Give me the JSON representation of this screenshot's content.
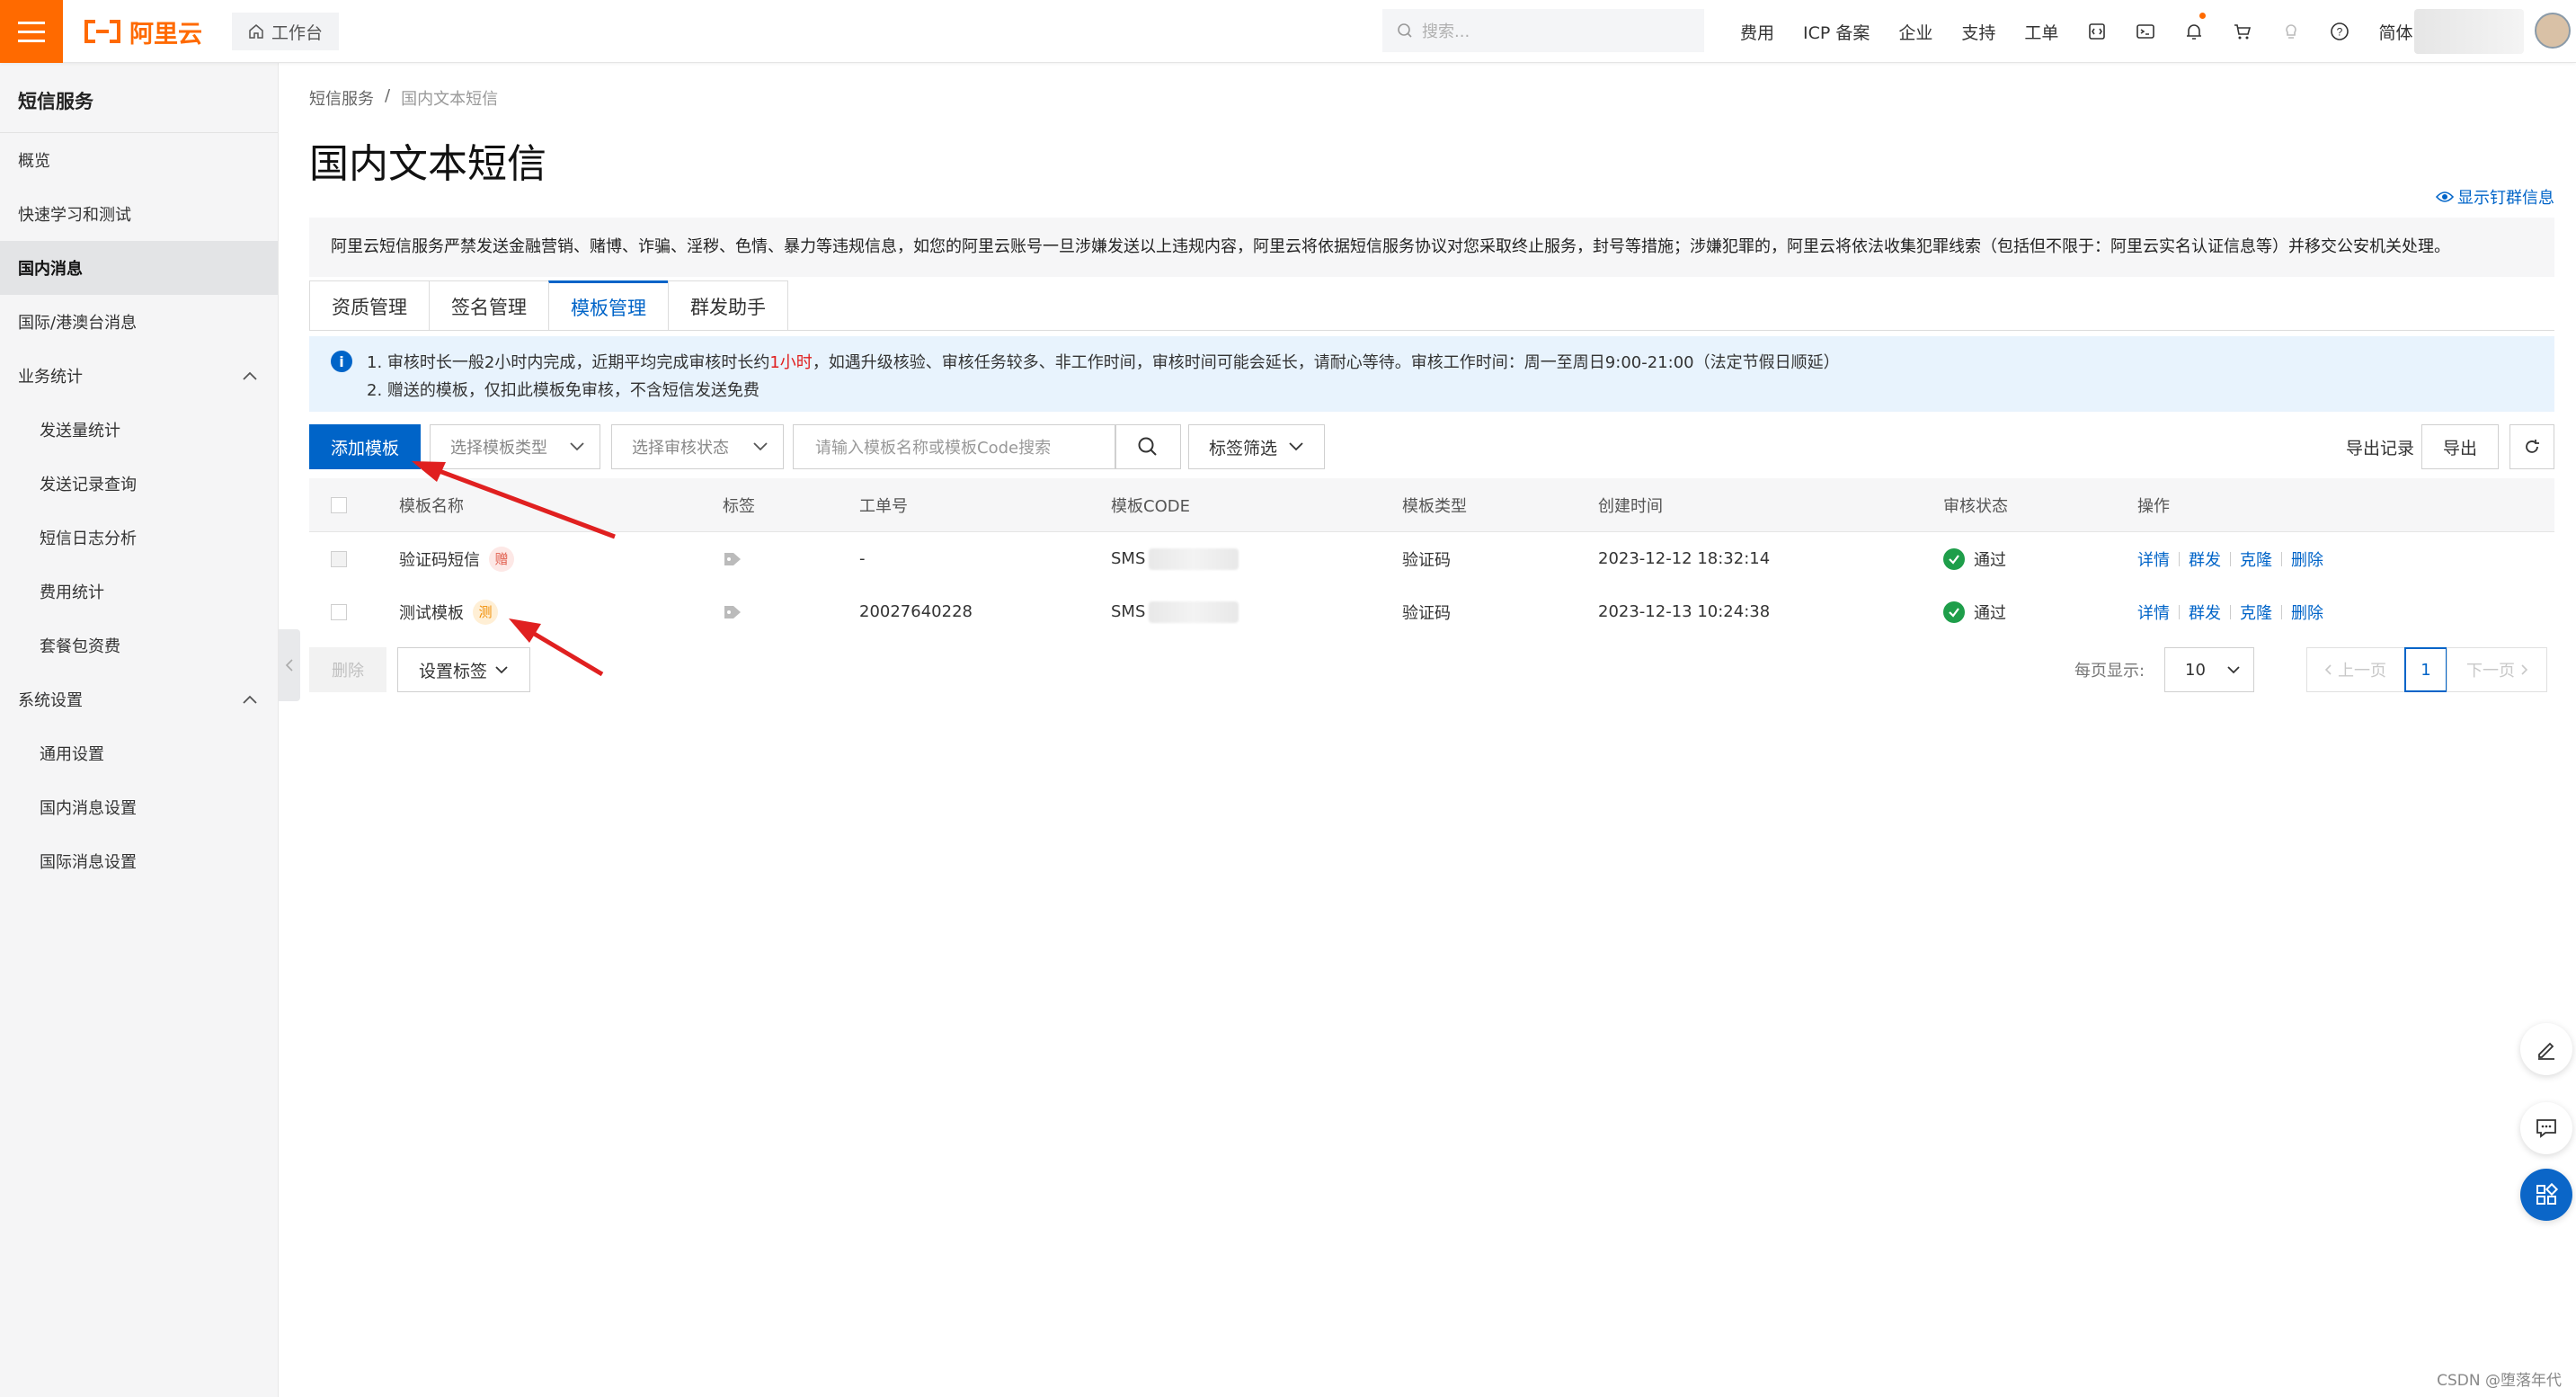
{
  "topbar": {
    "logo_text": "阿里云",
    "workbench_label": "工作台",
    "search_placeholder": "搜索...",
    "nav_items": [
      "费用",
      "ICP 备案",
      "企业",
      "支持",
      "工单"
    ],
    "lang": "简体",
    "icons": [
      "code-icon",
      "terminal-icon",
      "bell-icon",
      "cart-icon",
      "bulb-icon",
      "help-icon"
    ]
  },
  "sidebar": {
    "title": "短信服务",
    "items": [
      {
        "label": "概览"
      },
      {
        "label": "快速学习和测试"
      },
      {
        "label": "国内消息"
      },
      {
        "label": "国际/港澳台消息"
      }
    ],
    "group1": {
      "label": "业务统计",
      "items": [
        "发送量统计",
        "发送记录查询",
        "短信日志分析",
        "费用统计",
        "套餐包资费"
      ]
    },
    "group2": {
      "label": "系统设置",
      "items": [
        "通用设置",
        "国内消息设置",
        "国际消息设置"
      ]
    }
  },
  "breadcrumb": [
    "短信服务",
    "国内文本短信"
  ],
  "page_title": "国内文本短信",
  "show_group_info": "显示钉群信息",
  "notice": "阿里云短信服务严禁发送金融营销、赌博、诈骗、淫秽、色情、暴力等违规信息，如您的阿里云账号一旦涉嫌发送以上违规内容，阿里云将依据短信服务协议对您采取终止服务，封号等措施；涉嫌犯罪的，阿里云将依法收集犯罪线索（包括但不限于：阿里云实名认证信息等）并移交公安机关处理。",
  "tabs": [
    "资质管理",
    "签名管理",
    "模板管理",
    "群发助手"
  ],
  "active_tab": 2,
  "info": {
    "line1_pre": "1. 审核时长一般2小时内完成，近期平均完成审核时长约",
    "line1_red": "1小时",
    "line1_post": "，如遇升级核验、审核任务较多、非工作时间，审核时间可能会延长，请耐心等待。审核工作时间：周一至周日9:00-21:00（法定节假日顺延）",
    "line2": "2. 赠送的模板，仅扣此模板免审核，不含短信发送免费"
  },
  "toolbar": {
    "add_button": "添加模板",
    "type_select_placeholder": "选择模板类型",
    "status_select_placeholder": "选择审核状态",
    "search_placeholder": "请输入模板名称或模板Code搜索",
    "tag_filter": "标签筛选",
    "export_log": "导出记录",
    "export": "导出"
  },
  "table": {
    "headers": [
      "模板名称",
      "标签",
      "工单号",
      "模板CODE",
      "模板类型",
      "创建时间",
      "审核状态",
      "操作"
    ],
    "rows": [
      {
        "name": "验证码短信",
        "badge": "赠",
        "ticket": "-",
        "code": "SMS",
        "type": "验证码",
        "created": "2023-12-12 18:32:14",
        "status": "通过"
      },
      {
        "name": "测试模板",
        "badge": "测",
        "ticket": "20027640228",
        "code": "SMS",
        "type": "验证码",
        "created": "2023-12-13 10:24:38",
        "status": "通过"
      }
    ],
    "actions": [
      "详情",
      "群发",
      "克隆",
      "删除"
    ]
  },
  "bottom": {
    "delete_button": "删除",
    "set_tag_button": "设置标签",
    "per_page_label": "每页显示:",
    "per_page_value": "10",
    "prev": "上一页",
    "current_page": "1",
    "next": "下一页"
  },
  "watermark": "CSDN @堕落年代",
  "colors": {
    "brand": "#ff6a00",
    "primary": "#0064c8",
    "success": "#1e9e4a",
    "arrow": "#e02020"
  }
}
